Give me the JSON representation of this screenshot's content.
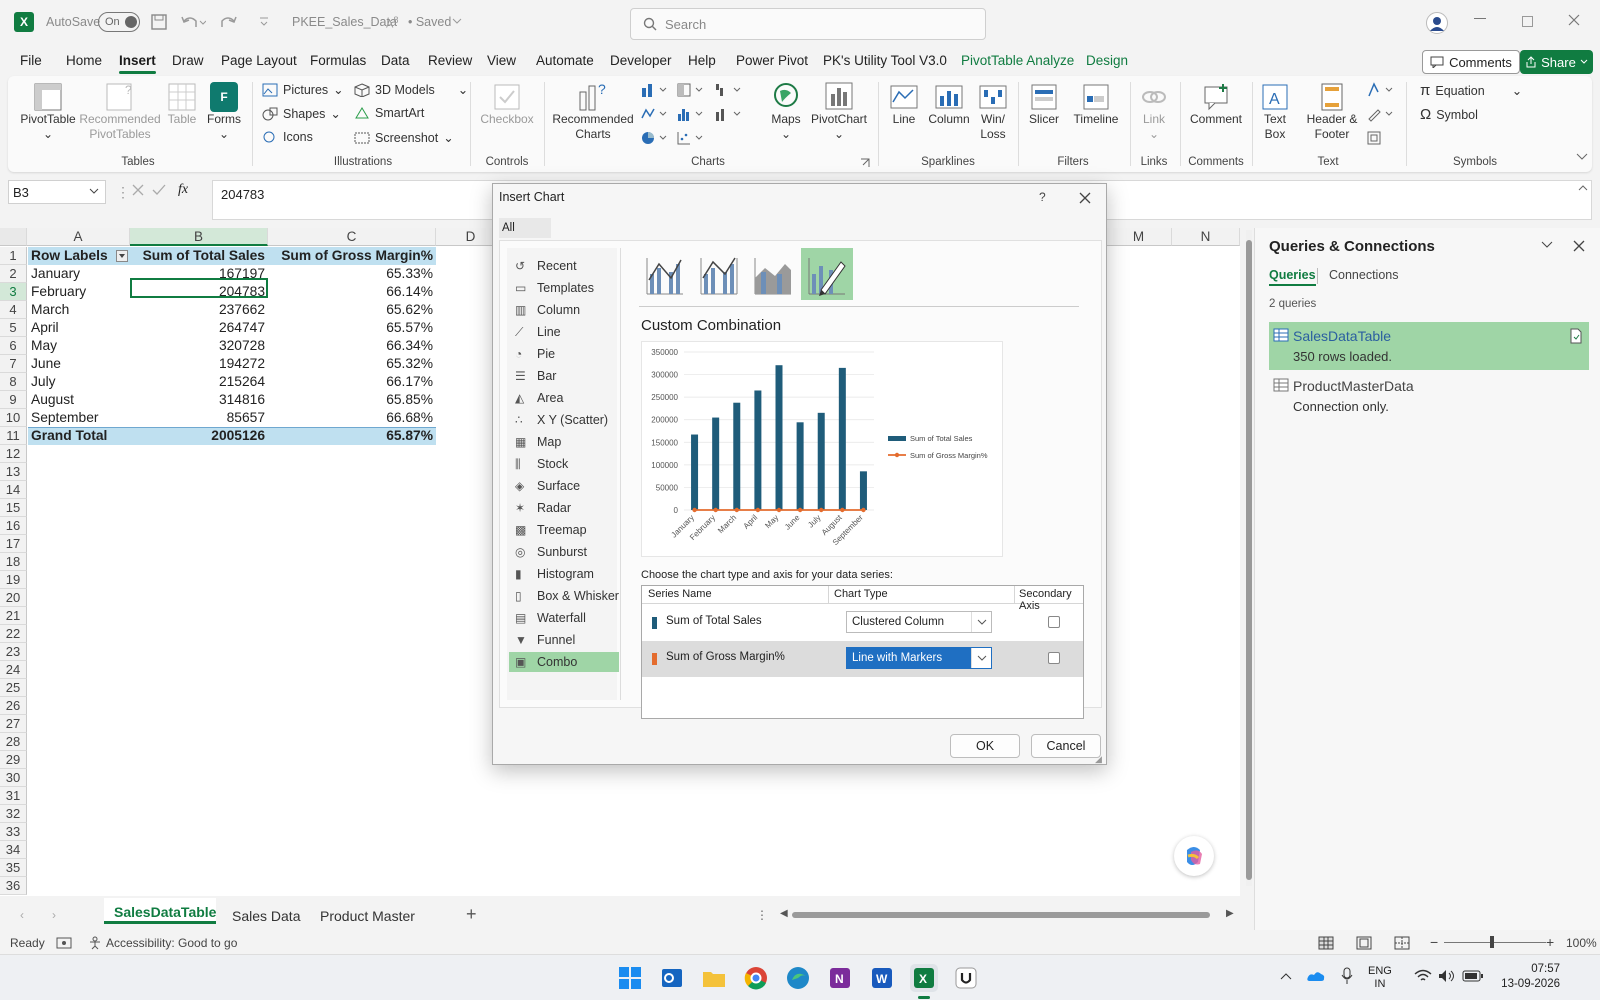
{
  "titlebar": {
    "autosave_label": "AutoSave",
    "autosave_state": "On",
    "filename": "PKEE_Sales_Data",
    "save_status": "• Saved",
    "search_placeholder": "Search"
  },
  "menu_tabs": [
    {
      "label": "File"
    },
    {
      "label": "Home"
    },
    {
      "label": "Insert",
      "active": true
    },
    {
      "label": "Draw"
    },
    {
      "label": "Page Layout"
    },
    {
      "label": "Formulas"
    },
    {
      "label": "Data"
    },
    {
      "label": "Review"
    },
    {
      "label": "View"
    },
    {
      "label": "Automate"
    },
    {
      "label": "Developer"
    },
    {
      "label": "Help"
    },
    {
      "label": "Power Pivot"
    },
    {
      "label": "PK's Utility Tool V3.0"
    },
    {
      "label": "PivotTable Analyze"
    },
    {
      "label": "Design"
    }
  ],
  "comments_label": "Comments",
  "share_label": "Share",
  "ribbon": {
    "pivottable": "PivotTable",
    "recommended_pivot": "Recommended PivotTables",
    "table": "Table",
    "forms": "Forms",
    "group_tables": "Tables",
    "pictures": "Pictures",
    "shapes": "Shapes",
    "icons": "Icons",
    "models3d": "3D Models",
    "smartart": "SmartArt",
    "screenshot": "Screenshot",
    "group_illustrations": "Illustrations",
    "checkbox": "Checkbox",
    "group_controls": "Controls",
    "recommended_charts": "Recommended Charts",
    "maps": "Maps",
    "pivotchart": "PivotChart",
    "group_charts": "Charts",
    "line": "Line",
    "column": "Column",
    "winloss": "Win/ Loss",
    "group_sparklines": "Sparklines",
    "slicer": "Slicer",
    "timeline": "Timeline",
    "group_filters": "Filters",
    "link": "Link",
    "group_links": "Links",
    "comment": "Comment",
    "group_comments": "Comments",
    "textbox": "Text Box",
    "header_footer": "Header & Footer",
    "group_text": "Text",
    "equation": "Equation",
    "symbol": "Symbol",
    "group_symbols": "Symbols"
  },
  "formula_bar": {
    "cell_ref": "B3",
    "fx": "fx",
    "value": "204783"
  },
  "columns": [
    "A",
    "B",
    "C",
    "D",
    "M",
    "N"
  ],
  "rows": [
    "1",
    "2",
    "3",
    "4",
    "5",
    "6",
    "7",
    "8",
    "9",
    "10",
    "11",
    "12",
    "13",
    "14",
    "15",
    "16",
    "17",
    "18",
    "19",
    "20",
    "21",
    "22",
    "23",
    "24",
    "25",
    "26",
    "27",
    "28",
    "29",
    "30",
    "31",
    "32",
    "33",
    "34",
    "35",
    "36"
  ],
  "pivot": {
    "headers": [
      "Row Labels",
      "Sum of Total Sales",
      "Sum of Gross Margin%"
    ],
    "data": [
      [
        "January",
        "167197",
        "65.33%"
      ],
      [
        "February",
        "204783",
        "66.14%"
      ],
      [
        "March",
        "237662",
        "65.62%"
      ],
      [
        "April",
        "264747",
        "65.57%"
      ],
      [
        "May",
        "320728",
        "66.34%"
      ],
      [
        "June",
        "194272",
        "65.32%"
      ],
      [
        "July",
        "215264",
        "66.17%"
      ],
      [
        "August",
        "314816",
        "65.85%"
      ],
      [
        "September",
        "85657",
        "66.68%"
      ]
    ],
    "total": [
      "Grand Total",
      "2005126",
      "65.87%"
    ]
  },
  "sheet_tabs": [
    "SalesDataTable",
    "Sales Data",
    "Product Master"
  ],
  "status": {
    "ready": "Ready",
    "accessibility": "Accessibility: Good to go",
    "zoom": "100%"
  },
  "taskbar": {
    "lang": "ENG",
    "region": "IN",
    "time": "07:57",
    "date": "13-09-2026"
  },
  "queries": {
    "title": "Queries & Connections",
    "tab_queries": "Queries",
    "tab_connections": "Connections",
    "count": "2 queries",
    "items": [
      {
        "name": "SalesDataTable",
        "status": "350 rows loaded."
      },
      {
        "name": "ProductMasterData",
        "status": "Connection only."
      }
    ]
  },
  "dialog": {
    "title": "Insert Chart",
    "help": "?",
    "tab": "All Charts",
    "chart_types": [
      "Recent",
      "Templates",
      "Column",
      "Line",
      "Pie",
      "Bar",
      "Area",
      "X Y (Scatter)",
      "Map",
      "Stock",
      "Surface",
      "Radar",
      "Treemap",
      "Sunburst",
      "Histogram",
      "Box & Whisker",
      "Waterfall",
      "Funnel",
      "Combo"
    ],
    "selected_type": "Combo",
    "subtype_heading": "Custom Combination",
    "series_prompt": "Choose the chart type and axis for your data series:",
    "table_headers": [
      "Series Name",
      "Chart Type",
      "Secondary Axis"
    ],
    "series_rows": [
      {
        "name": "Sum of Total Sales",
        "type": "Clustered Column",
        "color": "#1f5c7a"
      },
      {
        "name": "Sum of Gross Margin%",
        "type": "Line with Markers",
        "color": "#e46c2e"
      }
    ],
    "ok": "OK",
    "cancel": "Cancel"
  },
  "chart_data": {
    "type": "bar",
    "categories": [
      "January",
      "February",
      "March",
      "April",
      "May",
      "June",
      "July",
      "August",
      "September"
    ],
    "series": [
      {
        "name": "Sum of Total Sales",
        "type": "bar",
        "values": [
          167197,
          204783,
          237662,
          264747,
          320728,
          194272,
          215264,
          314816,
          85657
        ],
        "color": "#1f5c7a"
      },
      {
        "name": "Sum of Gross Margin%",
        "type": "line",
        "values": [
          0.6533,
          0.6614,
          0.6562,
          0.6557,
          0.6634,
          0.6532,
          0.6617,
          0.6585,
          0.6668
        ],
        "color": "#e46c2e"
      }
    ],
    "yticks": [
      "0",
      "50000",
      "100000",
      "150000",
      "200000",
      "250000",
      "300000",
      "350000"
    ],
    "ylim": [
      0,
      350000
    ],
    "legend_position": "right"
  }
}
